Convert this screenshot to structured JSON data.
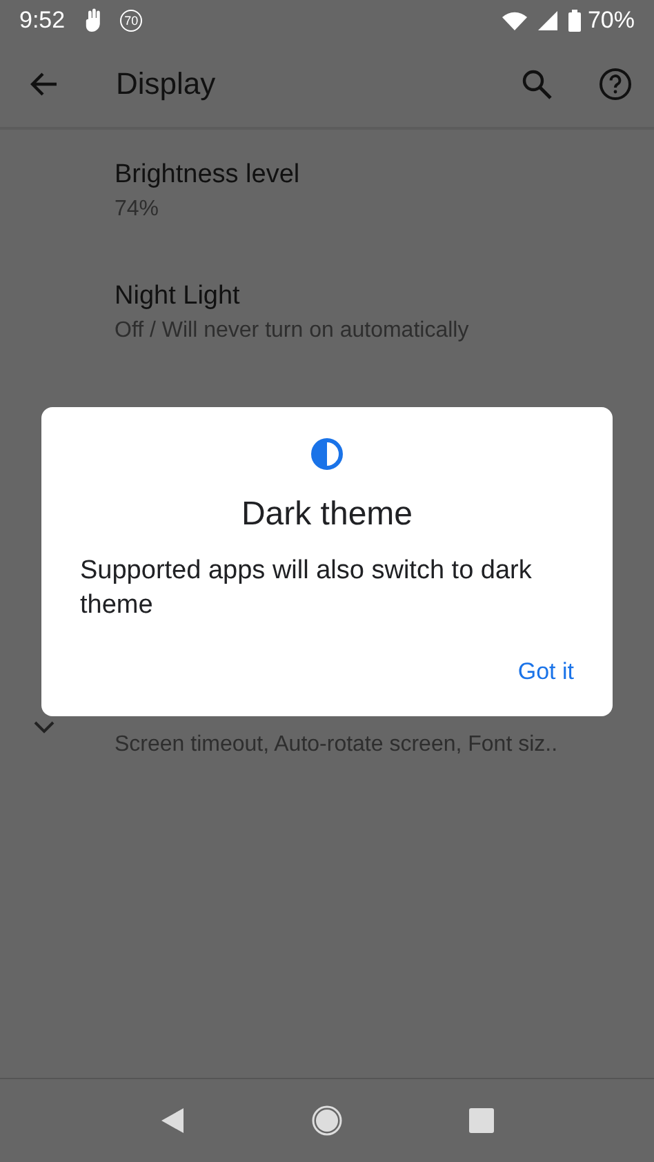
{
  "status_bar": {
    "time": "9:52",
    "badge": "70",
    "battery": "70%"
  },
  "app_bar": {
    "title": "Display"
  },
  "settings": [
    {
      "title": "Brightness level",
      "summary": "74%"
    },
    {
      "title": "Night Light",
      "summary": "Off / Will never turn on automatically"
    }
  ],
  "advanced": {
    "summary": "Screen timeout, Auto-rotate screen, Font siz.."
  },
  "dialog": {
    "title": "Dark theme",
    "message": "Supported apps will also switch to dark theme",
    "button": "Got it"
  }
}
